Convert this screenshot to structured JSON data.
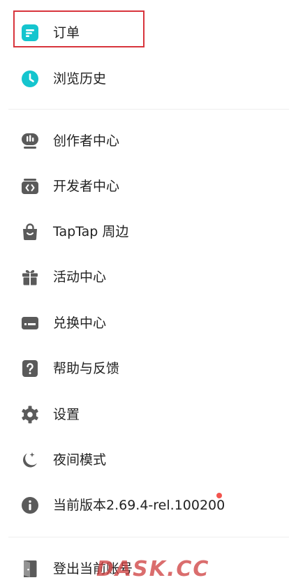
{
  "menu": {
    "orders": {
      "label": "订单",
      "icon": "order-icon"
    },
    "history": {
      "label": "浏览历史",
      "icon": "clock-icon"
    },
    "creator": {
      "label": "创作者中心",
      "icon": "creator-icon"
    },
    "developer": {
      "label": "开发者中心",
      "icon": "code-icon"
    },
    "merch": {
      "label": "TapTap 周边",
      "icon": "shopping-bag-icon"
    },
    "events": {
      "label": "活动中心",
      "icon": "gift-icon"
    },
    "redeem": {
      "label": "兑换中心",
      "icon": "card-icon"
    },
    "help": {
      "label": "帮助与反馈",
      "icon": "help-icon"
    },
    "settings": {
      "label": "设置",
      "icon": "gear-icon"
    },
    "night": {
      "label": "夜间模式",
      "icon": "moon-icon"
    },
    "version": {
      "label": "当前版本2.69.4-rel.100200",
      "icon": "info-icon"
    },
    "logout": {
      "label": "登出当前账号",
      "icon": "logout-icon"
    }
  },
  "colors": {
    "accent": "#15c5ce",
    "icon_gray": "#5a5a5a",
    "highlight_border": "#d8343c",
    "badge_dot": "#f2544e",
    "divider": "#eeeeee"
  },
  "watermark": "DASK.CC"
}
